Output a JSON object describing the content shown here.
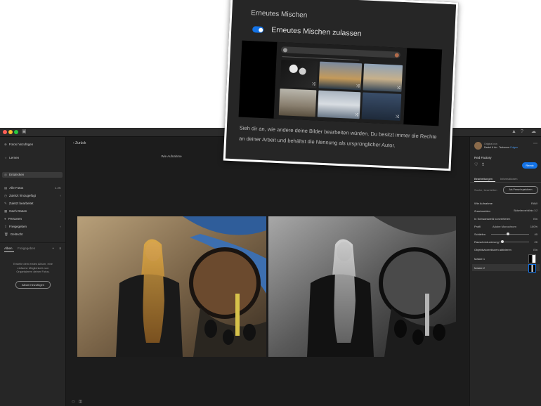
{
  "sidebar": {
    "add_photos": "Fotos hinzufügen",
    "learn": "Lernen",
    "discover": "Entdecken",
    "all_photos": "Alle Fotos",
    "all_photos_count": "1.2K",
    "recently_added": "Zuletzt hinzugefügt",
    "recently_edited": "Zuletzt bearbeitet",
    "by_date": "Nach Datum",
    "people": "Personen",
    "shared": "Freigegeben",
    "deleted": "Gelöscht",
    "tab_albums": "Alben",
    "tab_shared": "Freigegeben",
    "albums_empty_text": "Erstelle dein erstes Album, eine einfache Möglichkeit zum Organisieren deiner Fotos.",
    "add_album_button": "Album hinzufügen"
  },
  "center": {
    "back_label": "Zurück",
    "photo_caption": "Wie Aufnahme"
  },
  "right_panel": {
    "original_by": "Original von",
    "author": "Daniel & An.. Tschemer",
    "follow": "Folgen",
    "photo_name": "Red Factory",
    "remix_button": "Remix",
    "tab_edits": "Bearbeitungen",
    "tab_info": "Informationen",
    "search_placeholder": "Suche, bearbeiten",
    "save_preset": "Als Preset speichern",
    "rows": [
      {
        "label": "Wie Aufnahme",
        "value": "RAW"
      },
      {
        "label": "Zuschneiden",
        "value": "Bildseitenverhältnis: 3:2"
      },
      {
        "label": "In Schwarzweiß konvertieren",
        "value": "Ein"
      },
      {
        "label": "Profil",
        "value": "Adobe Monochrom"
      },
      {
        "label": "Schärfen",
        "value": "40"
      },
      {
        "label": "Rauschreduzierung",
        "value": "20"
      },
      {
        "label": "Objektivkorrekturen aktivieren",
        "value": "Ein"
      },
      {
        "label": "Maske 1",
        "value": ""
      },
      {
        "label": "Maske 2",
        "value": ""
      }
    ],
    "profile_amount": "100%"
  },
  "popup": {
    "title": "Erneutes Mischen",
    "toggle_label": "Erneutes Mischen zulassen",
    "description": "Sieh dir an, wie andere deine Bilder bearbeiten würden. Du besitzt immer die Rechte an deiner Arbeit und behältst die Nennung als ursprünglicher Autor."
  },
  "colors": {
    "accent": "#1473e6",
    "background": "#1e1e1e",
    "panel": "#262626"
  }
}
